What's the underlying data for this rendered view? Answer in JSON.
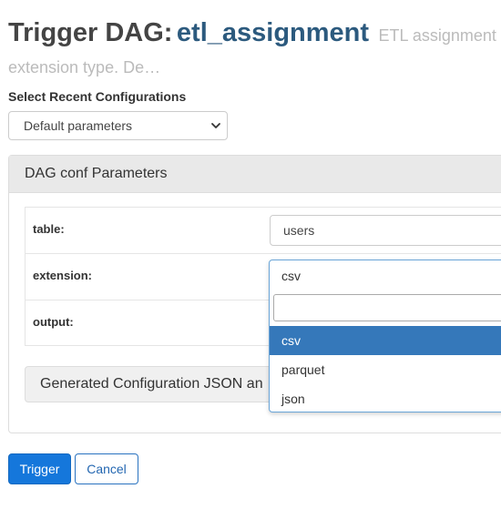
{
  "header": {
    "title_prefix": "Trigger DAG:",
    "dag_id": "etl_assignment",
    "description_part1": "ETL assignment",
    "description_part2": "extension type. De…"
  },
  "recent_configs": {
    "label": "Select Recent Configurations",
    "selected": "Default parameters"
  },
  "conf_panel": {
    "title": "DAG conf Parameters",
    "params": [
      {
        "label": "table:",
        "value": "users"
      },
      {
        "label": "extension:",
        "value": "csv"
      },
      {
        "label": "output:",
        "value": ""
      }
    ],
    "generated_label": "Generated Configuration JSON an"
  },
  "extension_dropdown": {
    "current": "csv",
    "search_value": "",
    "options": [
      "csv",
      "parquet",
      "json"
    ],
    "highlighted": "csv"
  },
  "actions": {
    "trigger_label": "Trigger",
    "cancel_label": "Cancel"
  },
  "colors": {
    "dag_id": "#2c5a7e",
    "highlight": "#3578ba",
    "primary_button": "#1577db",
    "cancel_text": "#2467b1"
  }
}
